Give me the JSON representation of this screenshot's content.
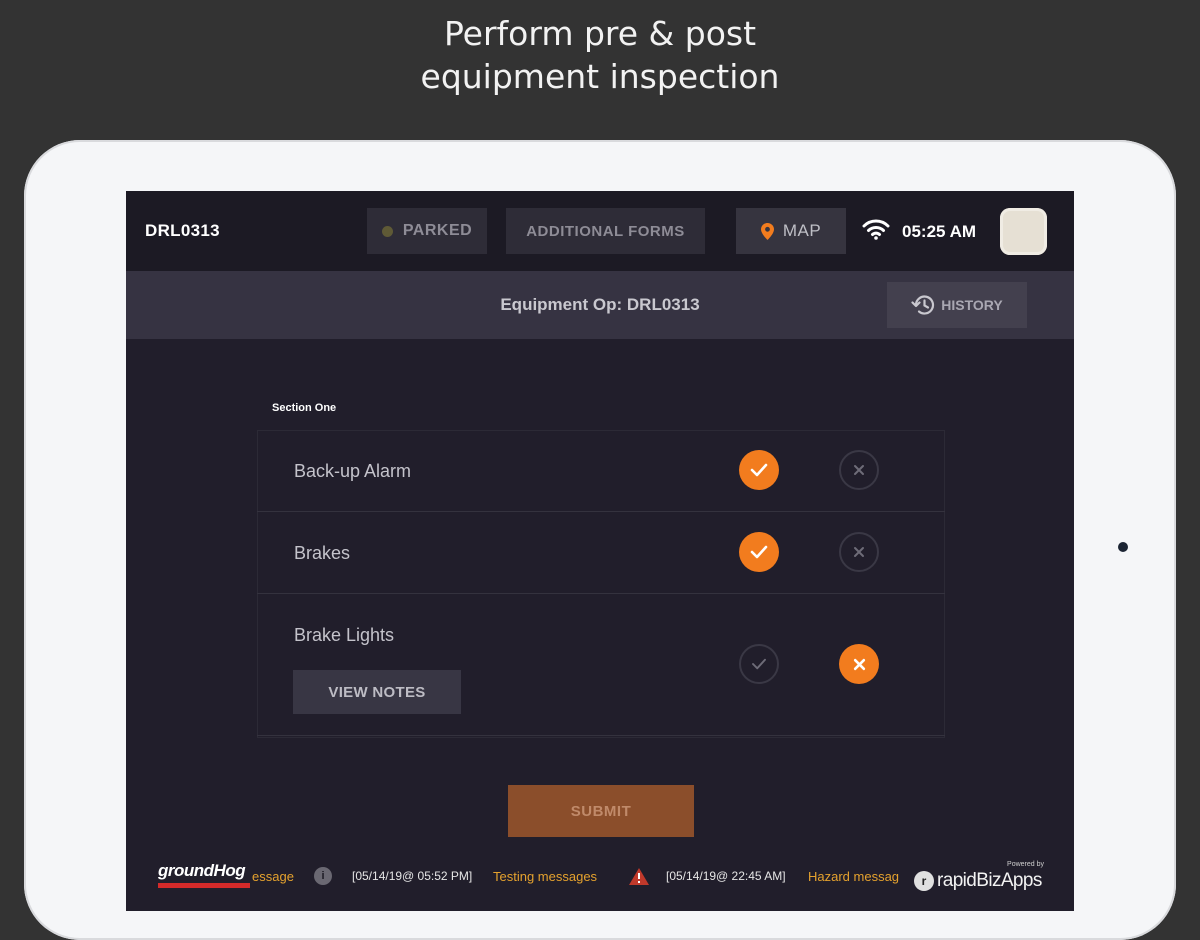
{
  "headline": {
    "line1": "Perform pre & post",
    "line2": "equipment inspection"
  },
  "topbar": {
    "unit_id": "DRL0313",
    "parked_label": "PARKED",
    "forms_label": "ADDITIONAL FORMS",
    "map_label": "MAP",
    "time": "05:25 AM"
  },
  "subheader": {
    "title": "Equipment Op: DRL0313",
    "history_label": "HISTORY"
  },
  "section": {
    "label": "Section One",
    "items": [
      {
        "label": "Back-up Alarm",
        "status": "pass"
      },
      {
        "label": "Brakes",
        "status": "pass"
      },
      {
        "label": "Brake Lights",
        "status": "fail",
        "notes_label": "VIEW NOTES"
      }
    ]
  },
  "submit_label": "SUBMIT",
  "ticker": {
    "brand": "groundHog",
    "msg1_fragment": "essage",
    "msg2_time": "[05/14/19@ 05:52 PM]",
    "msg2_text": "Testing messages",
    "msg3_time": "[05/14/19@ 22:45 AM]",
    "msg3_text": "Hazard messag",
    "powered_by": "Powered by",
    "vendor": "rapidBizApps"
  },
  "colors": {
    "accent": "#f27c1e",
    "background": "#211e2b",
    "ticker_text": "#e5a22e"
  }
}
